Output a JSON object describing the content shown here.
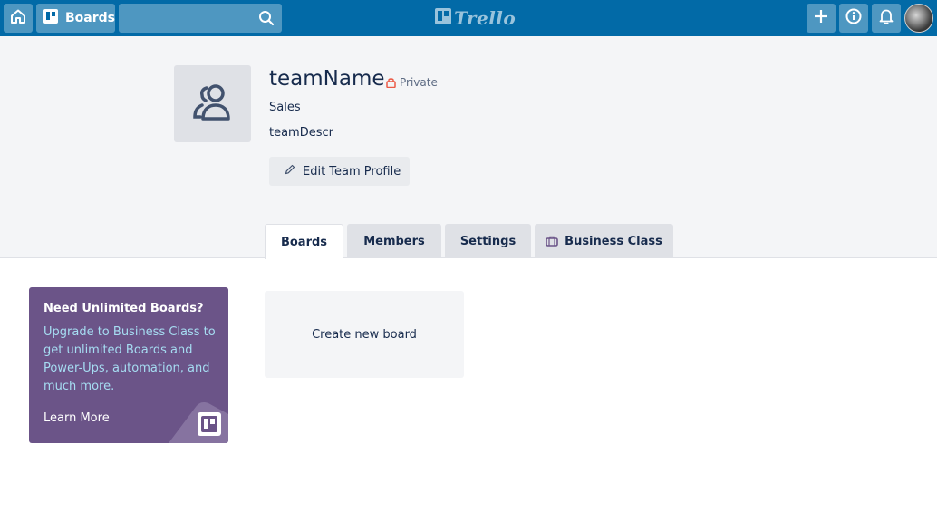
{
  "header": {
    "home_icon": "home-icon",
    "boards_label": "Boards",
    "search_placeholder": "",
    "logo_text": "Trello",
    "add_icon": "plus-icon",
    "info_icon": "info-icon",
    "bell_icon": "bell-icon",
    "brand_color": "#026aa7"
  },
  "team": {
    "name": "teamName",
    "visibility": "Private",
    "type": "Sales",
    "description": "teamDescr",
    "edit_label": "Edit Team Profile"
  },
  "tabs": [
    {
      "label": "Boards",
      "active": true
    },
    {
      "label": "Members",
      "active": false
    },
    {
      "label": "Settings",
      "active": false
    },
    {
      "label": "Business Class",
      "active": false
    }
  ],
  "upsell": {
    "title": "Need Unlimited Boards?",
    "body": "Upgrade to Business Class to get unlimited Boards and Power-Ups, automation, and much more.",
    "link": "Learn More",
    "color": "#6b5488"
  },
  "create_board": {
    "label": "Create new board"
  }
}
